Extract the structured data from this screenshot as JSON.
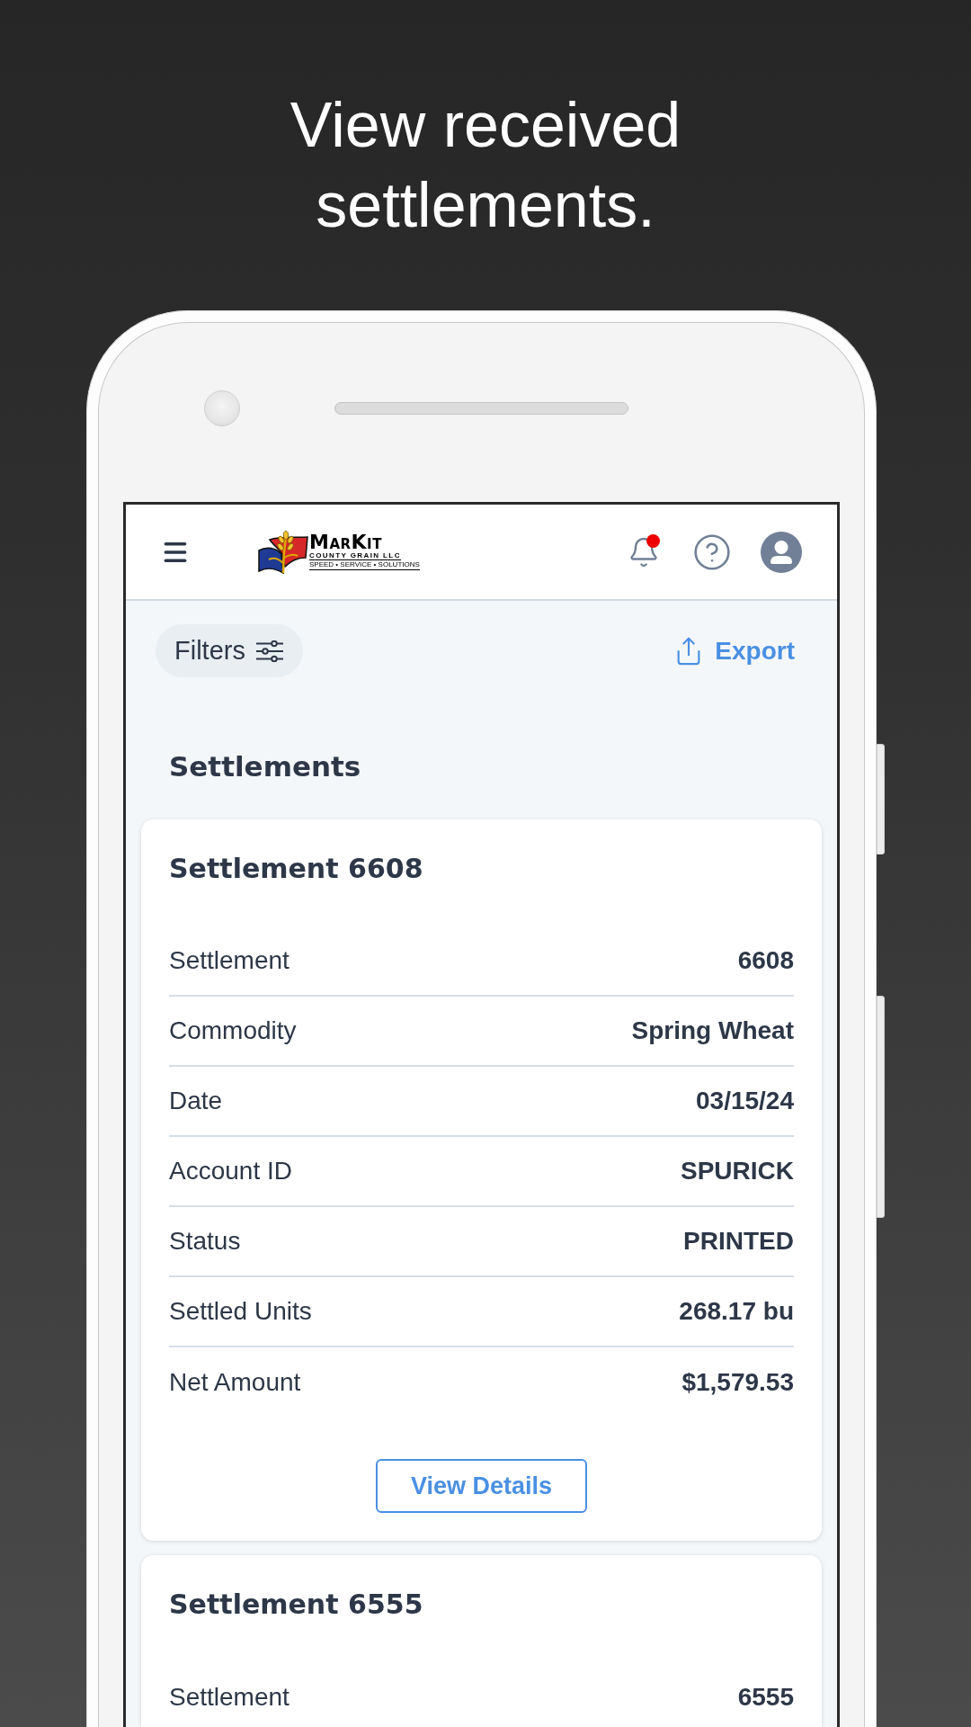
{
  "headline": "View received settlements.",
  "app_header": {
    "logo": {
      "name": "MarKit",
      "subtitle": "COUNTY GRAIN LLC",
      "tagline": "SPEED • SERVICE • SOLUTIONS"
    },
    "notifications": {
      "unread": true
    }
  },
  "toolbar": {
    "filters": "Filters",
    "export": "Export"
  },
  "page_title": "Settlements",
  "settlements": [
    {
      "title": "Settlement 6608",
      "fields": [
        {
          "label": "Settlement",
          "value": "6608"
        },
        {
          "label": "Commodity",
          "value": "Spring Wheat"
        },
        {
          "label": "Date",
          "value": "03/15/24"
        },
        {
          "label": "Account ID",
          "value": "SPURICK"
        },
        {
          "label": "Status",
          "value": "PRINTED"
        },
        {
          "label": "Settled Units",
          "value": "268.17 bu"
        },
        {
          "label": "Net Amount",
          "value": "$1,579.53"
        }
      ],
      "button": "View Details"
    },
    {
      "title": "Settlement 6555",
      "fields": [
        {
          "label": "Settlement",
          "value": "6555"
        }
      ]
    }
  ]
}
